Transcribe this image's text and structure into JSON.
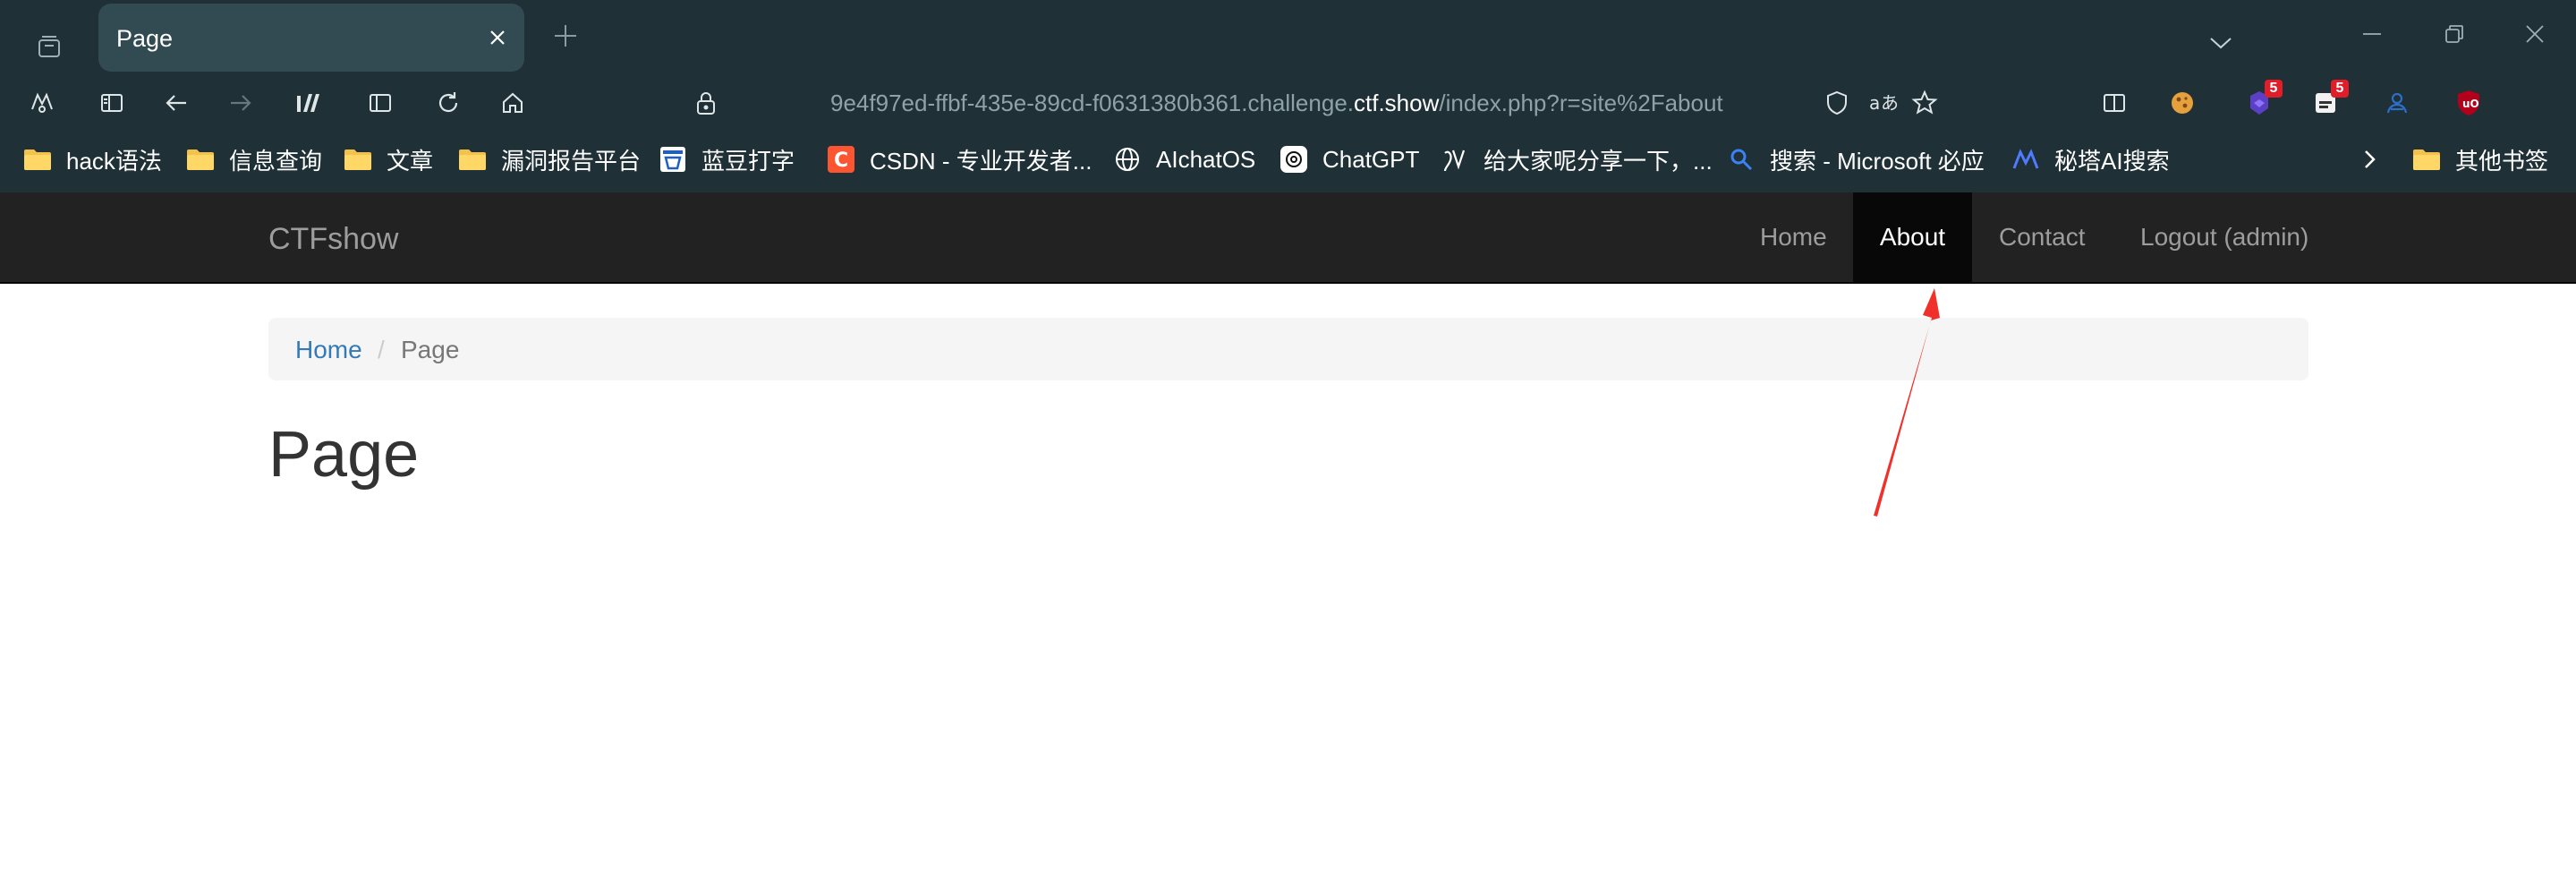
{
  "tab": {
    "title": "Page"
  },
  "address_bar": {
    "url_prefix": "9e4f97ed-ffbf-435e-89cd-f0631380b361.challenge.",
    "url_domain": "ctf.show",
    "url_path": "/index.php?r=site%2Fabout"
  },
  "extensions": [
    {
      "icon": "extension-badge-purple-icon",
      "badge": "5"
    },
    {
      "icon": "extension-badge-red-icon",
      "badge": "5"
    }
  ],
  "bookmarks": [
    {
      "label": "hack语法",
      "icon": "folder-icon"
    },
    {
      "label": "信息查询",
      "icon": "folder-icon"
    },
    {
      "label": "文章",
      "icon": "folder-icon"
    },
    {
      "label": "漏洞报告平台",
      "icon": "folder-icon"
    },
    {
      "label": "蓝豆打字",
      "icon": "lanbo-site-icon"
    },
    {
      "label": "CSDN - 专业开发者...",
      "icon": "csdn-icon"
    },
    {
      "label": "AIchatOS",
      "icon": "globe-icon"
    },
    {
      "label": "ChatGPT",
      "icon": "chatgpt-icon"
    },
    {
      "label": "给大家呢分享一下，...",
      "icon": "site-icon"
    },
    {
      "label": "搜索 - Microsoft 必应",
      "icon": "bing-search-icon"
    },
    {
      "label": "秘塔AI搜索",
      "icon": "metaso-icon"
    }
  ],
  "other_bookmarks": "其他书签",
  "site": {
    "brand": "CTFshow",
    "nav": [
      {
        "label": "Home",
        "active": false
      },
      {
        "label": "About",
        "active": true
      },
      {
        "label": "Contact",
        "active": false
      },
      {
        "label": "Logout (admin)",
        "active": false
      }
    ],
    "breadcrumb": {
      "home": "Home",
      "separator": "/",
      "current": "Page"
    },
    "page_title": "Page"
  },
  "annotation": {
    "color": "#f0302a"
  },
  "colors": {
    "chrome_bg": "#1f3036",
    "tab_active": "#324a51",
    "navbar_bg": "#222222",
    "nav_active_bg": "#080808",
    "link": "#337ab7"
  }
}
